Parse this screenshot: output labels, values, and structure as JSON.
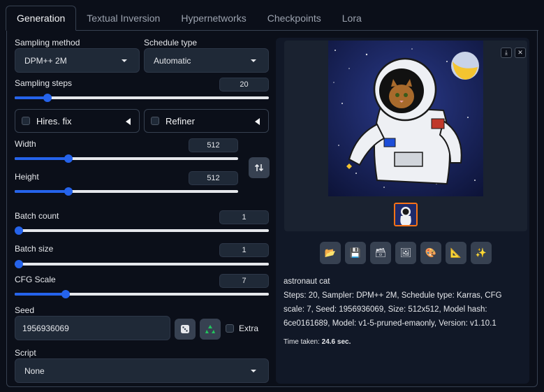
{
  "tabs": [
    "Generation",
    "Textual Inversion",
    "Hypernetworks",
    "Checkpoints",
    "Lora"
  ],
  "sampling": {
    "method_label": "Sampling method",
    "method_value": "DPM++ 2M",
    "schedule_label": "Schedule type",
    "schedule_value": "Automatic",
    "steps_label": "Sampling steps",
    "steps_value": "20",
    "steps_fraction": 0.13
  },
  "hires_fix": {
    "label": "Hires. fix",
    "checked": false
  },
  "refiner": {
    "label": "Refiner",
    "checked": false
  },
  "width": {
    "label": "Width",
    "value": "512",
    "fraction": 0.24
  },
  "height": {
    "label": "Height",
    "value": "512",
    "fraction": 0.24
  },
  "swap_icon": "swap-vertical-arrows",
  "batch_count": {
    "label": "Batch count",
    "value": "1",
    "fraction": 0.0
  },
  "batch_size": {
    "label": "Batch size",
    "value": "1",
    "fraction": 0.0
  },
  "cfg_scale": {
    "label": "CFG Scale",
    "value": "7",
    "fraction": 0.2
  },
  "seed": {
    "label": "Seed",
    "value": "1956936069",
    "extra_label": "Extra",
    "extra_checked": false,
    "random_icon": "dice",
    "reuse_icon": "recycle"
  },
  "script": {
    "label": "Script",
    "value": "None"
  },
  "gallery": {
    "download_icon": "download",
    "close_icon": "close",
    "thumbnail_selected": true
  },
  "tool_icons": [
    "folder",
    "save",
    "zip",
    "image",
    "palette",
    "ruler",
    "sparkle"
  ],
  "output": {
    "prompt": "astronaut cat",
    "params": "Steps: 20, Sampler: DPM++ 2M, Schedule type: Karras, CFG scale: 7, Seed: 1956936069, Size: 512x512, Model hash: 6ce0161689, Model: v1-5-pruned-emaonly, Version: v1.10.1",
    "time_label": "Time taken:",
    "time_value": "24.6 sec."
  },
  "colors": {
    "accent": "#2563eb",
    "background": "#0b0f19",
    "panel": "#1f2937"
  }
}
